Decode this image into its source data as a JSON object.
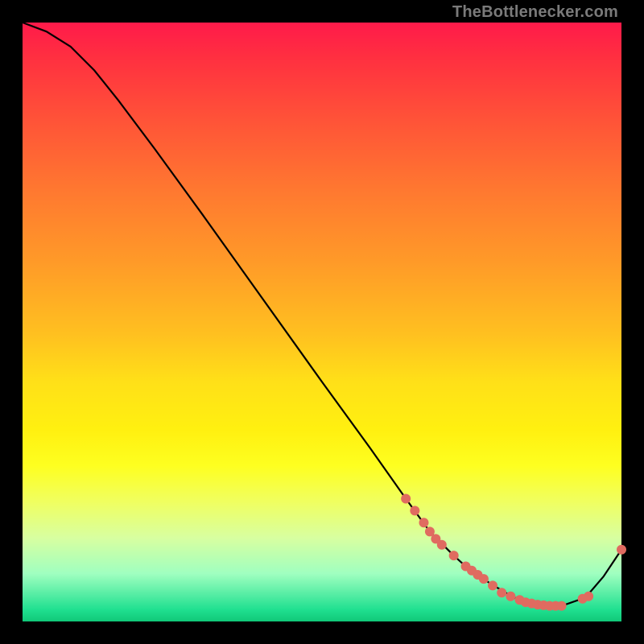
{
  "watermark": "TheBottlenecker.com",
  "chart_data": {
    "type": "line",
    "title": "",
    "xlabel": "",
    "ylabel": "",
    "xlim": [
      0,
      100
    ],
    "ylim": [
      0,
      100
    ],
    "grid": false,
    "curve": {
      "name": "bottleneck-curve",
      "color": "#000000",
      "x": [
        0,
        4,
        8,
        12,
        16,
        22,
        30,
        40,
        50,
        58,
        64,
        68,
        72,
        74,
        76,
        78,
        82,
        86,
        90,
        94,
        97,
        100
      ],
      "y": [
        100,
        98.5,
        96,
        92,
        87,
        79,
        68,
        54,
        40,
        29,
        20.5,
        15,
        11,
        9.2,
        7.8,
        6.4,
        4.0,
        2.8,
        2.6,
        4.0,
        7.5,
        12
      ]
    },
    "markers": {
      "name": "highlighted-points",
      "color": "#e06b60",
      "radius": 6,
      "x": [
        64,
        65.5,
        67,
        68,
        69,
        70,
        72,
        74,
        75,
        76,
        77,
        78.5,
        80,
        81.5,
        83,
        84,
        85,
        86,
        87,
        88,
        89,
        90,
        93.5,
        94.5,
        100
      ],
      "y": [
        20.5,
        18.5,
        16.5,
        15,
        13.8,
        12.8,
        11,
        9.2,
        8.5,
        7.8,
        7.1,
        6.0,
        4.8,
        4.2,
        3.6,
        3.2,
        3.0,
        2.8,
        2.7,
        2.6,
        2.6,
        2.6,
        3.8,
        4.2,
        12
      ]
    }
  }
}
